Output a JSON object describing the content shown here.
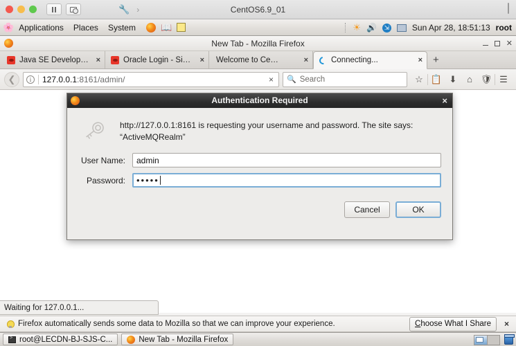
{
  "vm": {
    "title": "CentOS6.9_01",
    "controls": [
      "close-dot",
      "minimize-dot",
      "zoom-dot"
    ],
    "buttons": [
      "pause-button",
      "snapshot-button",
      "settings-wrench",
      "expand-chevron"
    ],
    "right_icon": "fullscreen-icon"
  },
  "gnome_panel": {
    "menus": [
      "Applications",
      "Places",
      "System"
    ],
    "launchers": [
      "firefox-launcher",
      "help-launcher",
      "text-editor-launcher"
    ],
    "tray": [
      "brightness-icon",
      "volume-icon",
      "bluetooth-icon",
      "display-icon"
    ],
    "clock": "Sun Apr 28, 18:51:13",
    "user": "root"
  },
  "firefox": {
    "window_title": "New Tab - Mozilla Firefox",
    "window_controls": [
      "minimize",
      "maximize",
      "close"
    ],
    "tabs": [
      {
        "label": "Java SE Developmen...",
        "favicon": "oracle-favicon",
        "active": false,
        "close": "×"
      },
      {
        "label": "Oracle Login - Single ...",
        "favicon": "oracle-favicon",
        "active": false,
        "close": "×"
      },
      {
        "label": "Welcome to CentOS",
        "favicon": "blank-favicon",
        "active": false,
        "close": "×"
      },
      {
        "label": "Connecting...",
        "favicon": "loading-spinner",
        "active": true,
        "close": "×"
      }
    ],
    "new_tab_label": "+",
    "urlbar": {
      "host": "127.0.0.1",
      "path": ":8161/admin/",
      "clear_label": "×",
      "identity_icon": "info-icon"
    },
    "search": {
      "placeholder": "Search",
      "icon": "search-icon"
    },
    "toolbar_icons": [
      "bookmark-star-icon",
      "library-icon",
      "downloads-icon",
      "home-icon",
      "pocket-icon",
      "menu-hamburger-icon"
    ],
    "status_tip": "Waiting for 127.0.0.1..."
  },
  "dialog": {
    "title": "Authentication Required",
    "close_label": "×",
    "icon": "key-icon",
    "message": "http://127.0.0.1:8161 is requesting your username and password. The site says: “ActiveMQRealm”",
    "fields": [
      {
        "label": "User Name:",
        "value": "admin",
        "type": "text",
        "focused": false
      },
      {
        "label": "Password:",
        "value": "•••••",
        "type": "password",
        "focused": true
      }
    ],
    "buttons": [
      {
        "label": "Cancel",
        "default": false
      },
      {
        "label": "OK",
        "default": true
      }
    ]
  },
  "notification": {
    "icon": "lightbulb-icon",
    "text": "Firefox automatically sends some data to Mozilla so that we can improve your experience.",
    "button_prefix": "C",
    "button_rest": "hoose What I Share",
    "close_label": "×"
  },
  "taskbar": {
    "items": [
      {
        "label": "root@LECDN-BJ-SJS-C...",
        "icon": "terminal-icon"
      },
      {
        "label": "New Tab - Mozilla Firefox",
        "icon": "firefox-icon"
      }
    ],
    "right": [
      "workspace-switcher",
      "trash-icon"
    ]
  },
  "colors": {
    "accent_blue": "#7aadd6",
    "firefox_orange": "#f28a1a",
    "oracle_red": "#e8362a",
    "spinner_blue": "#2196d8"
  }
}
